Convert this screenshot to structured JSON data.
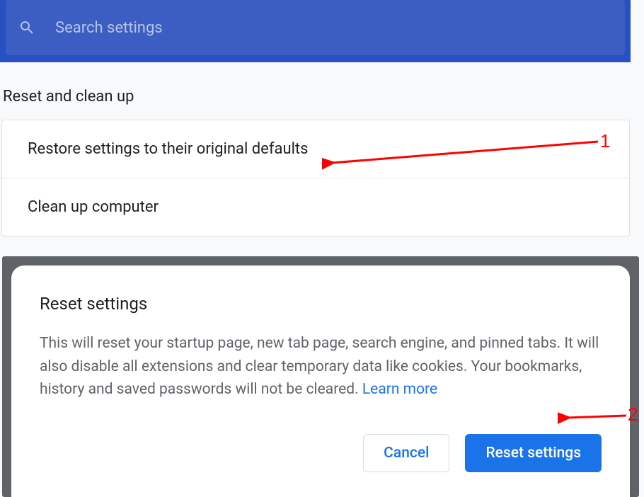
{
  "search": {
    "placeholder": "Search settings"
  },
  "section": {
    "title": "Reset and clean up",
    "rows": [
      {
        "label": "Restore settings to their original defaults"
      },
      {
        "label": "Clean up computer"
      }
    ]
  },
  "dialog": {
    "title": "Reset settings",
    "body": "This will reset your startup page, new tab page, search engine, and pinned tabs. It will also disable all extensions and clear temporary data like cookies. Your bookmarks, history and saved passwords will not be cleared. ",
    "learn_more": "Learn more",
    "cancel": "Cancel",
    "confirm": "Reset settings"
  },
  "annotations": {
    "one": "1",
    "two": "2"
  }
}
